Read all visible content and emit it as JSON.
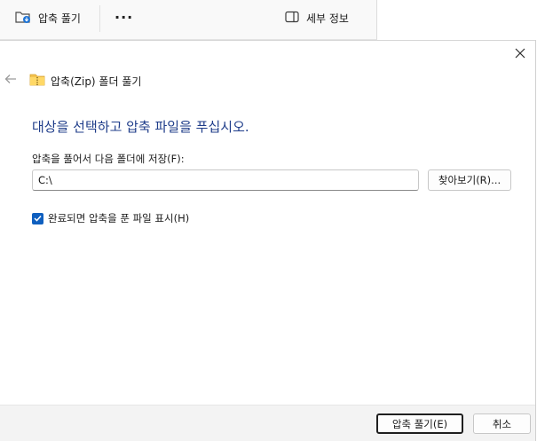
{
  "toolbar": {
    "extract_all_label": "압축 풀기",
    "more_label": "···",
    "details_label": "세부 정보"
  },
  "dialog": {
    "title": "압축(Zip) 폴더 풀기",
    "heading": "대상을 선택하고 압축 파일을 푸십시오.",
    "dest_label": "압축을 풀어서 다음 폴더에 저장(F):",
    "dest_value": "C:\\",
    "browse_label": "찾아보기(R)...",
    "show_files_label": "완료되면 압축을 푼 파일 표시(H)",
    "show_files_checked": true,
    "extract_button_label": "압축 풀기(E)",
    "cancel_button_label": "취소"
  },
  "colors": {
    "accent": "#0f5fbf",
    "heading": "#1f3d8a"
  },
  "icons": {
    "extract": "folder-extract-icon",
    "more": "more-icon",
    "details": "details-pane-icon",
    "close": "close-icon",
    "back": "back-arrow-icon",
    "zip_folder": "zip-folder-icon",
    "check": "checkmark-icon"
  }
}
